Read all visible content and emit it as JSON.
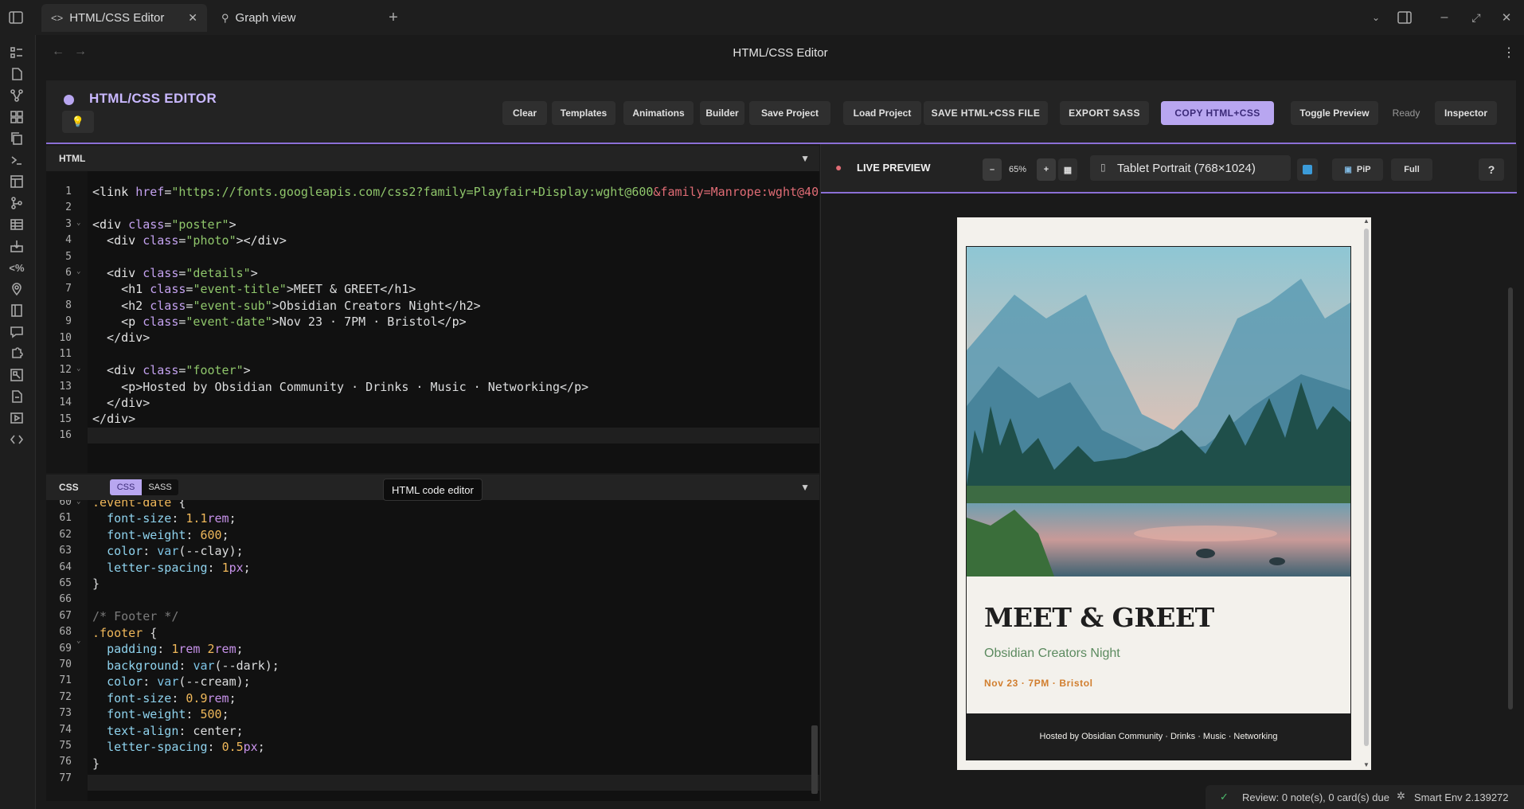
{
  "tabs": [
    {
      "label": "HTML/CSS Editor",
      "icon": "code-icon"
    },
    {
      "label": "Graph view",
      "icon": "graph-icon"
    }
  ],
  "view_title": "HTML/CSS Editor",
  "editor": {
    "title": "HTML/CSS EDITOR",
    "toolbar": [
      "Clear",
      "Templates",
      "Animations",
      "Builder",
      "Save Project",
      "Load Project"
    ],
    "actions": [
      "SAVE HTML+CSS FILE",
      "EXPORT SASS",
      "COPY HTML+CSS"
    ],
    "toggle_preview": "Toggle Preview",
    "status": "Ready",
    "inspector": "Inspector"
  },
  "html_pane": {
    "label": "HTML",
    "line_numbers": [
      "1",
      "2",
      "3",
      "4",
      "5",
      "6",
      "7",
      "8",
      "9",
      "10",
      "11",
      "12",
      "13",
      "14",
      "15",
      "16"
    ]
  },
  "css_pane": {
    "label": "CSS",
    "mode_css": "CSS",
    "mode_sass": "SASS",
    "line_numbers": [
      "60",
      "61",
      "62",
      "63",
      "64",
      "65",
      "66",
      "67",
      "68",
      "69",
      "70",
      "71",
      "72",
      "73",
      "74",
      "75",
      "76",
      "77"
    ]
  },
  "tooltip": "HTML code editor",
  "preview": {
    "title": "LIVE PREVIEW",
    "zoom": "65%",
    "device": "Tablet Portrait (768×1024)",
    "pip": "PiP",
    "full": "Full",
    "help": "?"
  },
  "poster": {
    "title": "MEET & GREET",
    "subtitle": "Obsidian Creators Night",
    "date": "Nov 23 · 7PM · Bristol",
    "footer": "Hosted by Obsidian Community · Drinks · Music · Networking"
  },
  "statusbar": {
    "review": "Review: 0 note(s), 0 card(s) due",
    "env": "Smart Env 2.139272"
  },
  "colors": {
    "accent": "#b8a6f0",
    "clay": "#d17e2e",
    "sage": "#5b8a5f",
    "dark": "#1e1e1e",
    "cream": "#f3f1ec"
  }
}
